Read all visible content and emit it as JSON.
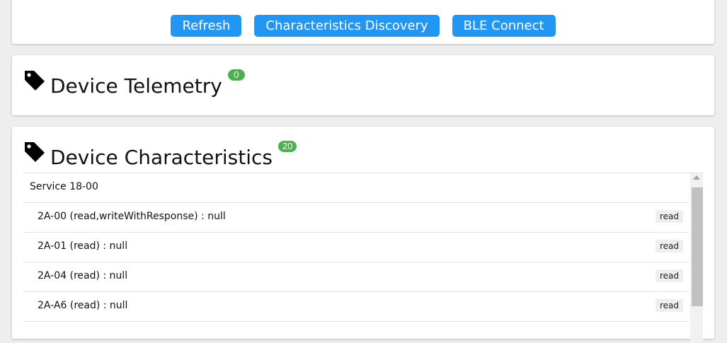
{
  "toolbar": {
    "refresh_label": "Refresh",
    "discovery_label": "Characteristics Discovery",
    "connect_label": "BLE Connect"
  },
  "telemetry": {
    "title": "Device Telemetry",
    "count": "0"
  },
  "characteristics": {
    "title": "Device Characteristics",
    "count": "20",
    "service": "Service 18-00",
    "items": [
      {
        "label": "2A-00 (read,writeWithResponse) : null",
        "action": "read"
      },
      {
        "label": "2A-01 (read) : null",
        "action": "read"
      },
      {
        "label": "2A-04 (read) : null",
        "action": "read"
      },
      {
        "label": "2A-A6 (read) : null",
        "action": "read"
      }
    ]
  },
  "colors": {
    "button": "#2196f3",
    "badge": "#4caf50"
  }
}
